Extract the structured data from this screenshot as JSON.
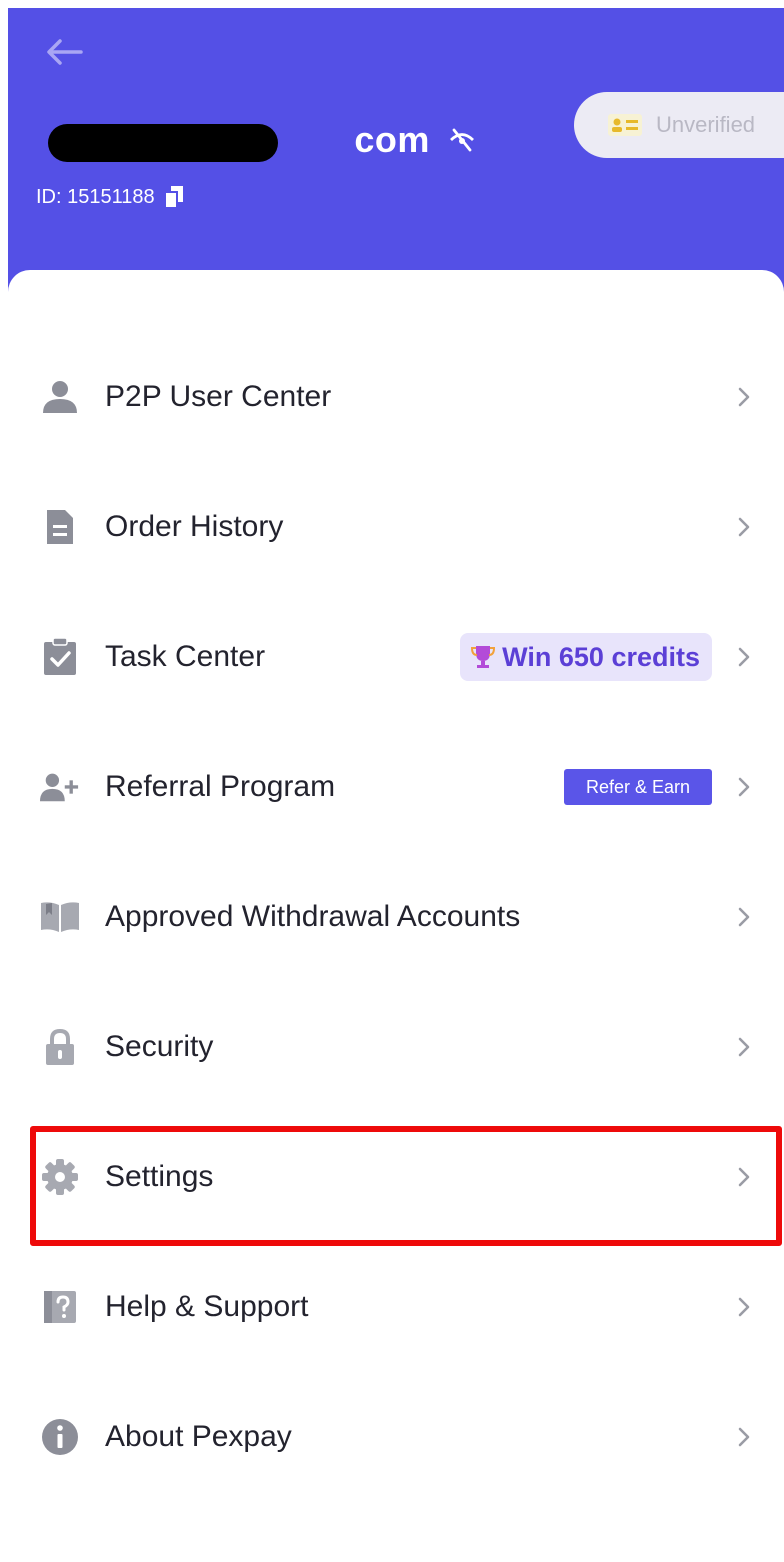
{
  "header": {
    "email_visible_suffix": "com",
    "user_id": "ID: 15151188",
    "verification_status": "Unverified",
    "back_icon": "arrow-left-icon",
    "eye_icon": "eye-slash-icon",
    "copy_icon": "copy-icon",
    "id_card_icon": "id-card-icon"
  },
  "menu": {
    "items": [
      {
        "label": "P2P User Center",
        "icon": "user-icon"
      },
      {
        "label": "Order History",
        "icon": "document-icon"
      },
      {
        "label": "Task Center",
        "icon": "clipboard-check-icon",
        "badge": "Win 650 credits"
      },
      {
        "label": "Referral Program",
        "icon": "user-plus-icon",
        "badge": "Refer & Earn"
      },
      {
        "label": "Approved Withdrawal Accounts",
        "icon": "book-icon"
      },
      {
        "label": "Security",
        "icon": "lock-icon"
      },
      {
        "label": "Settings",
        "icon": "gear-icon"
      },
      {
        "label": "Help & Support",
        "icon": "help-icon"
      },
      {
        "label": "About Pexpay",
        "icon": "info-icon"
      }
    ]
  },
  "colors": {
    "header_bg": "#5450E6",
    "icon_gray": "#8C8E98",
    "text_dark": "#23232E",
    "badge_purple": "#5B3FD6",
    "highlight_red": "#EE0A0A"
  }
}
